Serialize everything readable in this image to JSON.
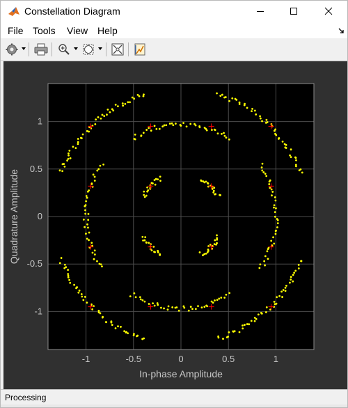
{
  "window": {
    "title": "Constellation Diagram"
  },
  "menu": {
    "items": [
      "File",
      "Tools",
      "View",
      "Help"
    ]
  },
  "toolbar": {
    "buttons": [
      "settings-icon",
      "print-icon",
      "zoom-in-icon",
      "fit-to-view-icon",
      "scale-axes-icon",
      "highlight-icon"
    ]
  },
  "status": {
    "text": "Processing"
  },
  "colors": {
    "figure_background": "#303030",
    "plot_background": "#000000",
    "axis_text": "#c8c8c8",
    "grid": "#4d4d4d",
    "received_points": "#ffff00",
    "reference_points": "#ff0000"
  },
  "chart_data": {
    "type": "scatter",
    "title": "",
    "xlabel": "In-phase Amplitude",
    "ylabel": "Quadrature Amplitude",
    "xlim": [
      -1.4,
      1.4
    ],
    "ylim": [
      -1.4,
      1.4
    ],
    "xticks": [
      -1,
      -0.5,
      0,
      0.5,
      1
    ],
    "yticks": [
      -1,
      -0.5,
      0,
      0.5,
      1
    ],
    "xtick_labels": [
      "-1",
      "-0.5",
      "0",
      "0.5",
      "1"
    ],
    "ytick_labels": [
      "1",
      "0.5",
      "0",
      "-0.5",
      "-1"
    ],
    "grid": true,
    "reference_points": [
      [
        -0.95,
        0.95
      ],
      [
        -0.32,
        0.95
      ],
      [
        0.32,
        0.95
      ],
      [
        0.95,
        0.95
      ],
      [
        -0.95,
        0.32
      ],
      [
        -0.32,
        0.32
      ],
      [
        0.32,
        0.32
      ],
      [
        0.95,
        0.32
      ],
      [
        -0.95,
        -0.32
      ],
      [
        -0.32,
        -0.32
      ],
      [
        0.32,
        -0.32
      ],
      [
        0.95,
        -0.32
      ],
      [
        -0.95,
        -0.95
      ],
      [
        -0.32,
        -0.95
      ],
      [
        0.32,
        -0.95
      ],
      [
        0.95,
        -0.95
      ]
    ],
    "received_arcs": [
      {
        "radius": 1.34,
        "from_deg": 107,
        "to_deg": 160,
        "count": 48
      },
      {
        "radius": 1.34,
        "from_deg": 20,
        "to_deg": 73,
        "count": 48
      },
      {
        "radius": 1.34,
        "from_deg": 200,
        "to_deg": 253,
        "count": 48
      },
      {
        "radius": 1.34,
        "from_deg": 287,
        "to_deg": 340,
        "count": 48
      },
      {
        "radius": 0.97,
        "from_deg": 58,
        "to_deg": 122,
        "count": 40
      },
      {
        "radius": 0.97,
        "from_deg": 238,
        "to_deg": 302,
        "count": 40
      },
      {
        "radius": 1.0,
        "from_deg": 147,
        "to_deg": 213,
        "count": 40
      },
      {
        "radius": 1.0,
        "from_deg": 327,
        "to_deg": 393,
        "count": 40
      },
      {
        "radius": 0.45,
        "from_deg": 28,
        "to_deg": 62,
        "count": 18
      },
      {
        "radius": 0.45,
        "from_deg": 118,
        "to_deg": 152,
        "count": 18
      },
      {
        "radius": 0.45,
        "from_deg": 208,
        "to_deg": 242,
        "count": 18
      },
      {
        "radius": 0.45,
        "from_deg": 298,
        "to_deg": 332,
        "count": 18
      }
    ]
  }
}
